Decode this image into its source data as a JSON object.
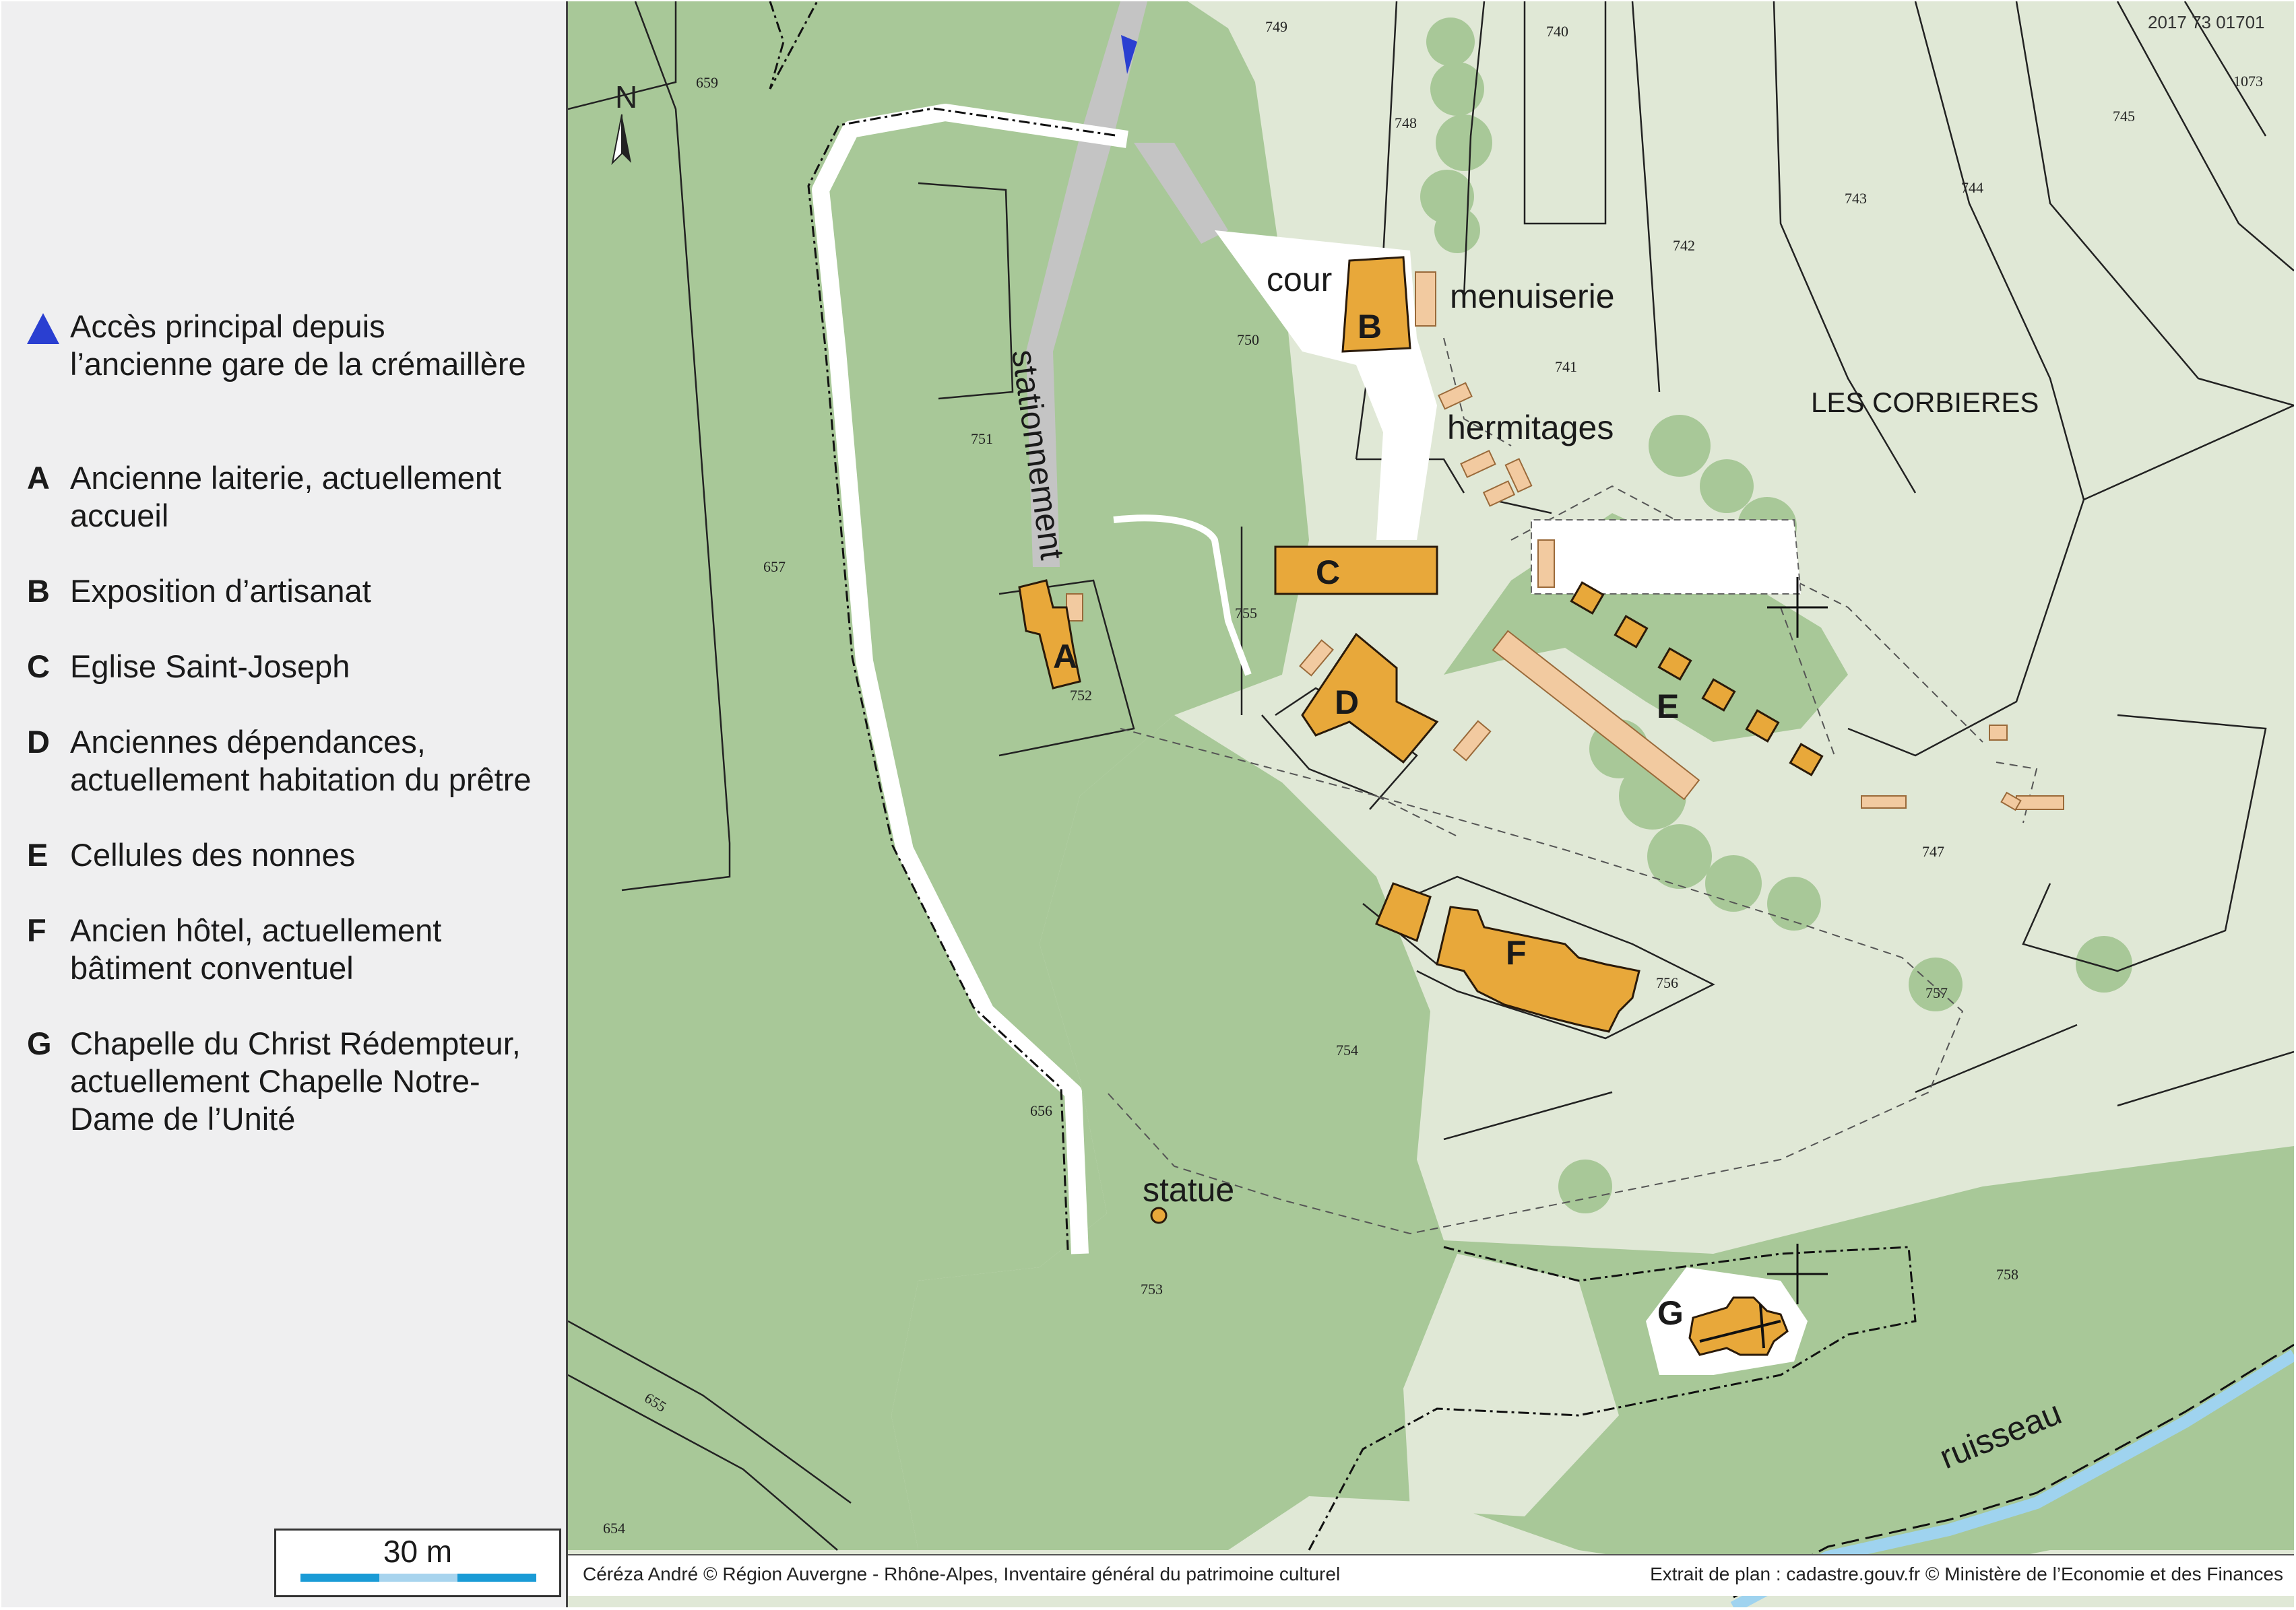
{
  "legend": {
    "items": [
      {
        "letter": "",
        "text": "Accès principal depuis\nl’ancienne gare de la crémaillère"
      },
      {
        "letter": "A",
        "text": "Ancienne laiterie, actuellement\naccueil"
      },
      {
        "letter": "B",
        "text": "Exposition d’artisanat"
      },
      {
        "letter": "C",
        "text": "Eglise Saint-Joseph"
      },
      {
        "letter": "D",
        "text": "Anciennes dépendances,\nactuellement habitation du prêtre"
      },
      {
        "letter": "E",
        "text": "Cellules des nonnes"
      },
      {
        "letter": "F",
        "text": "Ancien hôtel, actuellement\nbâtiment conventuel"
      },
      {
        "letter": "G",
        "text": "Chapelle du Christ Rédempteur,\nactuellement Chapelle Notre-\nDame de l’Unité"
      }
    ]
  },
  "scale": {
    "label": "30 m",
    "colors": [
      "#1a9bd6",
      "#a8d4ee",
      "#1a9bd6"
    ]
  },
  "map": {
    "reference": "2017 73 01701",
    "north": "N",
    "place_name": "LES CORBIERES",
    "labels": {
      "cour": "cour",
      "menuiserie": "menuiserie",
      "hermitages": "hermitages",
      "stationnement": "stationnement",
      "statue": "statue",
      "ruisseau": "ruisseau"
    },
    "building_letters": [
      "A",
      "B",
      "C",
      "D",
      "E",
      "F",
      "G"
    ],
    "parcels": [
      "749",
      "740",
      "659",
      "748",
      "745",
      "1073",
      "743",
      "744",
      "742",
      "750",
      "741",
      "751",
      "657",
      "755",
      "752",
      "747",
      "756",
      "757",
      "754",
      "656",
      "753",
      "758",
      "655",
      "654"
    ],
    "colors": {
      "forest": "#a8c898",
      "clearing": "#e0e8d6",
      "building": "#e8a83a",
      "annex": "#f2caa0",
      "access_marker": "#2a3fd1",
      "stream": "#9fd3ef",
      "parking": "#c4c4c4"
    }
  },
  "credits": {
    "left": "Céréza André © Région Auvergne - Rhône-Alpes, Inventaire général du patrimoine culturel",
    "right": "Extrait de plan : cadastre.gouv.fr © Ministère de l’Economie et des Finances"
  }
}
